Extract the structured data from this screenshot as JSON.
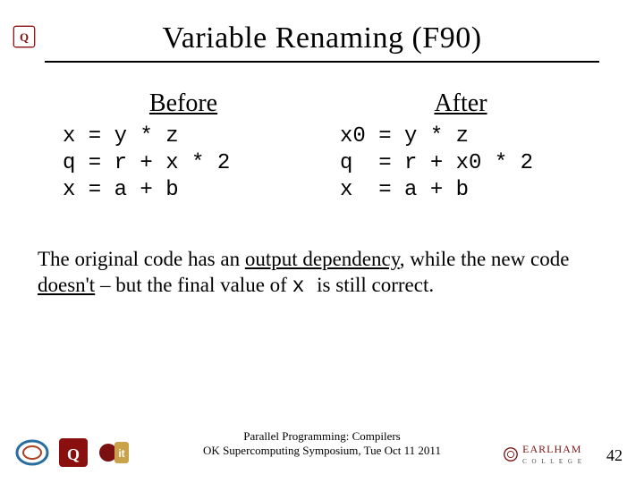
{
  "title": "Variable Renaming (F90)",
  "before": {
    "header": "Before",
    "code": "x = y * z\nq = r + x * 2\nx = a + b"
  },
  "after": {
    "header": "After",
    "code": "x0 = y * z\nq  = r + x0 * 2\nx  = a + b"
  },
  "explain": {
    "p1a": "The original code has an ",
    "output_dep": "output dependency",
    "p1b": ", while the new code ",
    "doesnt": "doesn't",
    "p1c": " – but the final value of ",
    "var": " x ",
    "p1d": " is still correct."
  },
  "footer": {
    "line1": "Parallel Programming: Compilers",
    "line2": "OK Supercomputing Symposium, Tue Oct 11 2011",
    "page": "42",
    "earlham": "EARLHAM",
    "earlham_sub": "C O L L E G E"
  }
}
